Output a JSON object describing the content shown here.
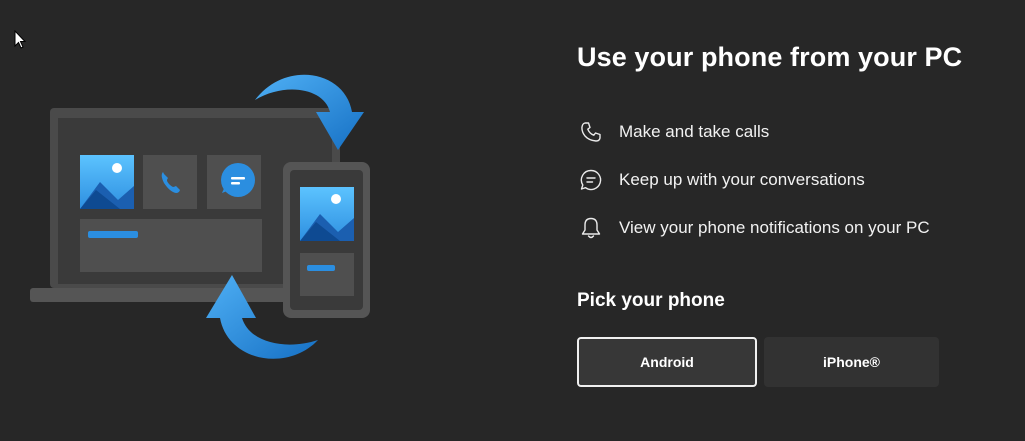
{
  "title": "Use your phone from your PC",
  "features": [
    {
      "icon": "phone-icon",
      "label": "Make and take calls"
    },
    {
      "icon": "chat-icon",
      "label": "Keep up with your conversations"
    },
    {
      "icon": "bell-icon",
      "label": "View your phone notifications on your PC"
    }
  ],
  "pick_heading": "Pick your phone",
  "buttons": {
    "android": "Android",
    "iphone": "iPhone®"
  },
  "colors": {
    "background": "#272727",
    "accent": "#2b8ee0",
    "selected_border": "#f0f0f0"
  }
}
